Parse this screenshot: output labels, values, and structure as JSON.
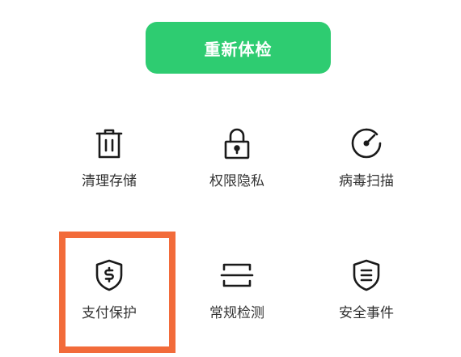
{
  "primary_action": {
    "label": "重新体检",
    "color": "#2ECC71"
  },
  "tools": [
    {
      "label": "清理存储",
      "icon": "trash-icon"
    },
    {
      "label": "权限隐私",
      "icon": "lock-icon"
    },
    {
      "label": "病毒扫描",
      "icon": "gauge-icon"
    },
    {
      "label": "支付保护",
      "icon": "shield-dollar-icon"
    },
    {
      "label": "常规检测",
      "icon": "scan-icon"
    },
    {
      "label": "安全事件",
      "icon": "shield-list-icon"
    }
  ],
  "highlight": {
    "target": "支付保护",
    "color": "#F26B3A"
  }
}
